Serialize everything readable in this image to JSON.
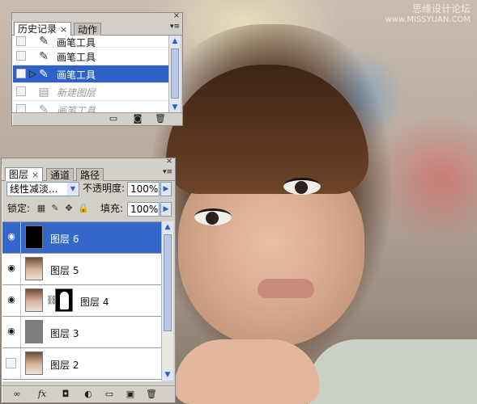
{
  "watermark": {
    "line1": "思缘设计论坛",
    "line2": "www.MISSYUAN.COM"
  },
  "history_panel": {
    "tabs": [
      "历史记录",
      "动作"
    ],
    "tab_close": "×",
    "items": [
      {
        "label": "画笔工具",
        "icon": "brush-icon",
        "state": "normal"
      },
      {
        "label": "画笔工具",
        "icon": "brush-icon",
        "state": "normal"
      },
      {
        "label": "画笔工具",
        "icon": "brush-icon",
        "state": "selected"
      },
      {
        "label": "新建图层",
        "icon": "new-layer-state-icon",
        "state": "dim"
      },
      {
        "label": "画笔工具",
        "icon": "brush-icon",
        "state": "dim"
      }
    ],
    "footer_icons": [
      "new-document-from-state-icon",
      "snapshot-icon",
      "trash-icon"
    ]
  },
  "layers_panel": {
    "tabs": [
      "图层",
      "通道",
      "路径"
    ],
    "tab_close": "×",
    "blend_mode": "线性减淡...",
    "opacity_label": "不透明度:",
    "opacity_value": "100%",
    "lock_label": "锁定:",
    "fill_label": "填充:",
    "fill_value": "100%",
    "layers": [
      {
        "name": "图层 6",
        "visible": true,
        "thumb": "black",
        "mask": false,
        "selected": true
      },
      {
        "name": "图层 5",
        "visible": true,
        "thumb": "photo",
        "mask": false,
        "selected": false
      },
      {
        "name": "图层 4",
        "visible": true,
        "thumb": "photo",
        "mask": true,
        "selected": false
      },
      {
        "name": "图层 3",
        "visible": true,
        "thumb": "gray",
        "mask": false,
        "selected": false
      },
      {
        "name": "图层 2",
        "visible": false,
        "thumb": "photo",
        "mask": false,
        "selected": false
      }
    ],
    "footer_icons": [
      "link-layers-icon",
      "fx-icon",
      "add-mask-icon",
      "adjustment-layer-icon",
      "new-group-icon",
      "new-layer-icon",
      "trash-icon"
    ],
    "fx_label": "fx"
  },
  "colors": {
    "selection": "#3566c9",
    "panel_bg": "#d4d0c8"
  }
}
